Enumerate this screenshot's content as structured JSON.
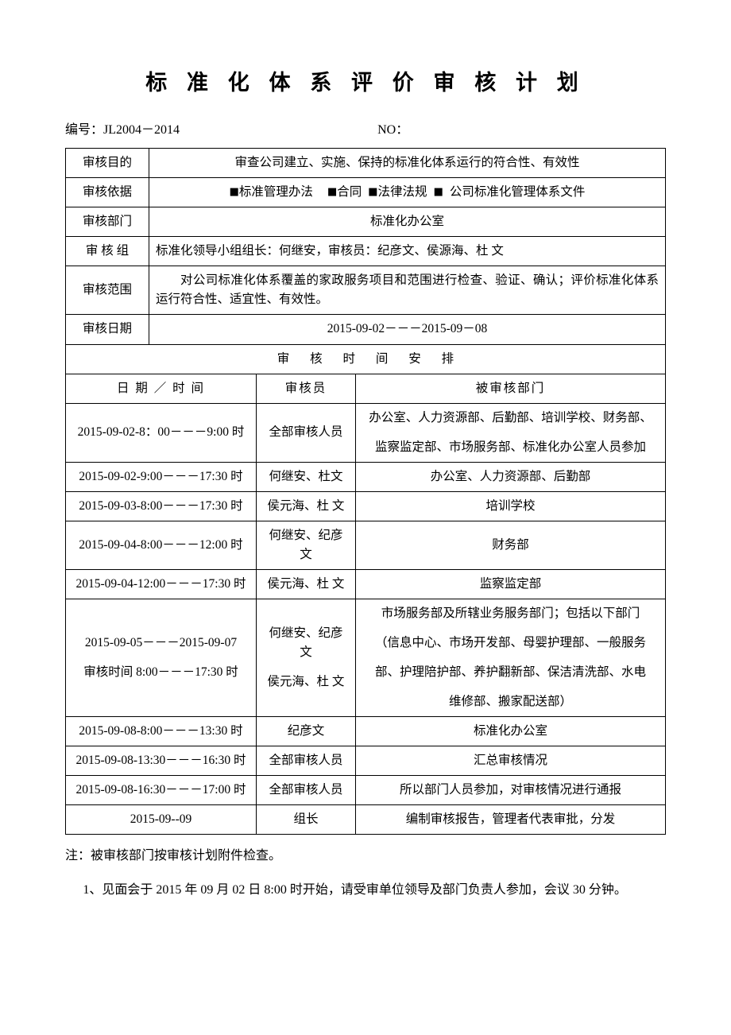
{
  "document": {
    "title": "标 准 化 体 系 评 价 审 核 计 划",
    "code_label": "编号：JL2004－2014",
    "no_label": "NO："
  },
  "info_table": {
    "rows": [
      {
        "label": "审核目的",
        "value": "审查公司建立、实施、保持的标准化体系运行的符合性、有效性"
      },
      {
        "label": "审核依据",
        "value": "■标准管理办法　　■合同　■法律法规 ■ 公司标准化管理体系文件"
      },
      {
        "label": "审核部门",
        "value": "标准化办公室"
      },
      {
        "label": "审 核 组",
        "value": "标准化领导小组组长：何继安，审核员：纪彦文、侯源海、杜 文"
      },
      {
        "label": "审核范围",
        "value": "对公司标准化体系覆盖的家政服务项目和范围进行检查、验证、确认；评价标准化体系运行符合性、适宜性、有效性。"
      },
      {
        "label": "审核日期",
        "value": "2015-09-02－－－2015-09－08"
      }
    ],
    "basis_items": [
      "标准管理办法",
      "合同",
      "法律法规",
      "公司标准化管理体系文件"
    ],
    "square_marker": "■"
  },
  "schedule": {
    "section_title": "审 核 时 间 安 排",
    "headers": {
      "date_time": "日 期 ／ 时 间",
      "auditor": "审核员",
      "department": "被审核部门"
    },
    "rows": [
      {
        "date_time": "2015-09-02-8：00－－－9:00 时",
        "auditor": "全部审核人员",
        "department_lines": [
          "办公室、人力资源部、后勤部、培训学校、财务部、",
          "监察监定部、市场服务部、标准化办公室人员参加"
        ]
      },
      {
        "date_time": "2015-09-02-9:00－－－17:30 时",
        "auditor": "何继安、杜文",
        "department_lines": [
          "办公室、人力资源部、后勤部"
        ]
      },
      {
        "date_time": "2015-09-03-8:00－－－17:30 时",
        "auditor": "侯元海、杜 文",
        "department_lines": [
          "培训学校"
        ]
      },
      {
        "date_time": "2015-09-04-8:00－－－12:00 时",
        "auditor": "何继安、纪彦文",
        "department_lines": [
          "财务部"
        ]
      },
      {
        "date_time": "2015-09-04-12:00－－－17:30 时",
        "auditor": "侯元海、杜 文",
        "department_lines": [
          "监察监定部"
        ]
      },
      {
        "date_time_lines": [
          "2015-09-05－－－2015-09-07",
          "审核时间 8:00－－－17:30 时"
        ],
        "auditor_lines": [
          "何继安、纪彦文",
          "侯元海、杜 文"
        ],
        "department_lines": [
          "市场服务部及所辖业务服务部门；包括以下部门",
          "（信息中心、市场开发部、母婴护理部、一般服务",
          "部、护理陪护部、养护翻新部、保洁清洗部、水电",
          "维修部、搬家配送部）"
        ]
      },
      {
        "date_time": "2015-09-08-8:00－－－13:30 时",
        "auditor": "纪彦文",
        "department_lines": [
          "标准化办公室"
        ]
      },
      {
        "date_time": "2015-09-08-13:30－－－16:30 时",
        "auditor": "全部审核人员",
        "department_lines": [
          "汇总审核情况"
        ]
      },
      {
        "date_time": "2015-09-08-16:30－－－17:00 时",
        "auditor": "全部审核人员",
        "department_lines": [
          "所以部门人员参加，对审核情况进行通报"
        ]
      },
      {
        "date_time": "2015-09--09",
        "auditor": "组长",
        "department_lines": [
          "编制审核报告，管理者代表审批，分发"
        ]
      }
    ]
  },
  "notes": {
    "note_main": "注：被审核部门按审核计划附件检查。",
    "note_1": "1、见面会于 2015 年 09 月 02 日 8:00 时开始，请受审单位领导及部门负责人参加，会议 30 分钟。"
  }
}
